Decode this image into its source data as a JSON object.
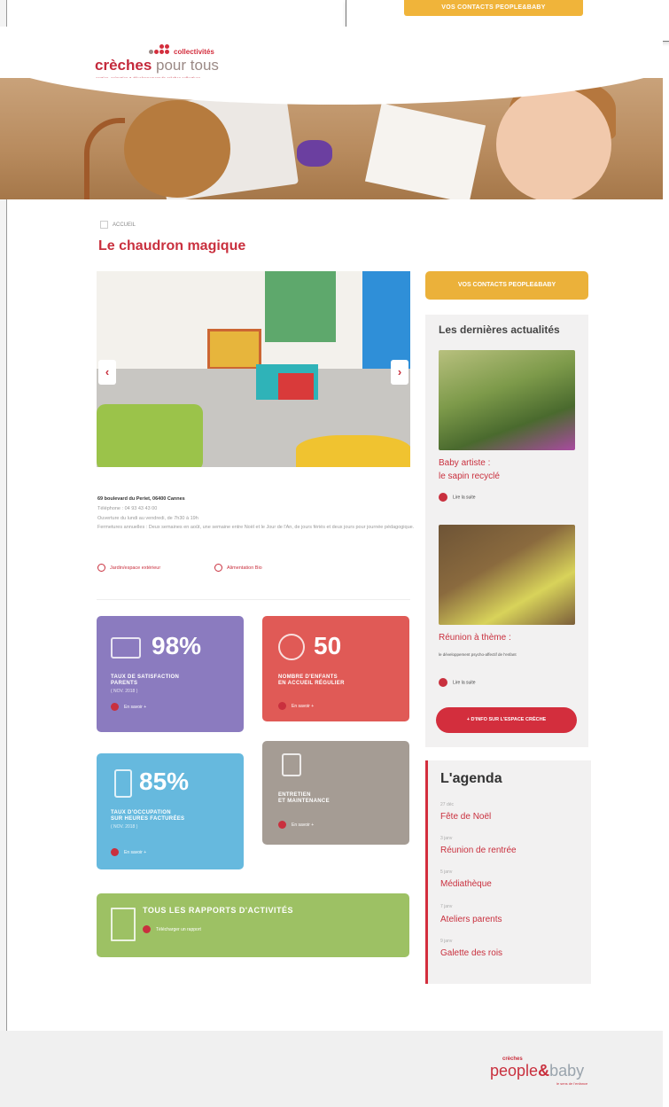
{
  "top_bar": {
    "contacts_button": "VOS CONTACTS PEOPLE&BABY"
  },
  "logo": {
    "collectivites": "collectivités",
    "creches": "crèches",
    "pour_tous": "pour tous",
    "tagline": "gestion, animation & développement de crèches collectives"
  },
  "breadcrumb": {
    "label": "ACCUEIL"
  },
  "page_title": "Le chaudron magique",
  "slider": {
    "prev": "‹",
    "next": "›"
  },
  "address": {
    "line1": "69 boulevard du Periet, 06400 Cannes",
    "phone": "Téléphone : 04 93 43 43 00",
    "hours": "Ouverture du lundi au vendredi, de 7h30 à 19h",
    "closures": "Fermetures annuelles : Deux semaines en août, une semaine entre Noël et le Jour de l'An, de jours fériés et deux jours pour journée pédagogique."
  },
  "features": {
    "garden": "Jardin/espace extérieur",
    "bio": "Alimentation Bio"
  },
  "stats": [
    {
      "value": "98%",
      "label": "TAUX DE SATISFACTION\nPARENTS",
      "sub": "( NOV. 2018 )",
      "more": "En savoir +",
      "color": "#8b7bbf"
    },
    {
      "value": "50",
      "label": "NOMBRE D'ENFANTS\nEN ACCUEIL RÉGULIER",
      "sub": "",
      "more": "En savoir +",
      "color": "#e05a56"
    },
    {
      "value": "85%",
      "label": "TAUX D'OCCUPATION\nSUR HEURES FACTURÉES",
      "sub": "( NOV. 2018 )",
      "more": "En savoir +",
      "color": "#66b9de"
    },
    {
      "value": "",
      "label": "ENTRETIEN\nET MAINTENANCE",
      "sub": "",
      "more": "En savoir +",
      "color": "#a59c94"
    }
  ],
  "reports": {
    "title": "TOUS LES RAPPORTS D'ACTIVITÉS",
    "download": "Télécharger un rapport",
    "color": "#9dc164"
  },
  "sidebar": {
    "contacts_button": "VOS CONTACTS PEOPLE&BABY",
    "news_title": "Les dernières actualités",
    "news": [
      {
        "title": "Baby artiste :\nle sapin recyclé",
        "desc": "",
        "read": "Lire la suite"
      },
      {
        "title": "Réunion à thème :",
        "desc": "le développement psycho-affectif de l'enfant",
        "read": "Lire la suite"
      }
    ],
    "cta": "+ D'INFO SUR L'ESPACE CRÈCHE"
  },
  "agenda": {
    "title": "L'agenda",
    "events": [
      {
        "date": "27 déc",
        "name": "Fête de Noël"
      },
      {
        "date": "3 janv",
        "name": "Réunion de rentrée"
      },
      {
        "date": "5 janv",
        "name": "Médiathèque"
      },
      {
        "date": "7 janv",
        "name": "Ateliers parents"
      },
      {
        "date": "9 janv",
        "name": "Galette des rois"
      }
    ]
  },
  "footer": {
    "creches": "crèches",
    "brand1": "people",
    "amp": "&",
    "brand2": "baby",
    "tagline": "le sens de l'enfance"
  }
}
